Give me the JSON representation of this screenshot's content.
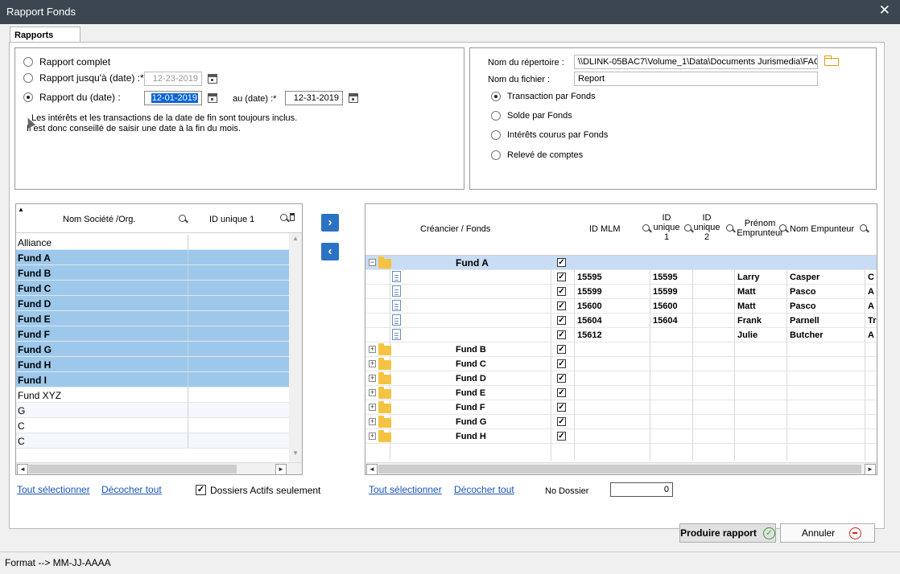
{
  "window": {
    "title": "Rapport Fonds",
    "close": "✕"
  },
  "tabs": {
    "active": "Rapports"
  },
  "report_options": {
    "full": "Rapport complet",
    "until": "Rapport jusqu'à (date) :*",
    "until_date": "12-23-2019",
    "from": "Rapport du (date) :",
    "from_date": "12-01-2019",
    "to_label": "au (date) :*",
    "to_date": "12-31-2019",
    "selected": "from",
    "note_line1": "Les intérêts et les transactions de la date de fin sont toujours inclus.",
    "note_line2": "Il est donc conseillé de saisir une date à la fin du mois."
  },
  "output": {
    "dir_label": "Nom du répertoire :",
    "dir_value": "\\\\DLINK-05BAC7\\Volume_1\\Data\\Documents Jurismedia\\FAC",
    "file_label": "Nom du fichier :",
    "file_value": "Report",
    "types": [
      "Transaction par Fonds",
      "Solde par Fonds",
      "Intérêts courus par Fonds",
      "Relevé de comptes"
    ],
    "selected_type": 0
  },
  "left_grid": {
    "sort_arrow": "▲",
    "col1": "Nom Société /Org.",
    "col2": "ID unique 1",
    "rows": [
      {
        "name": "Alliance",
        "selected": false
      },
      {
        "name": "Fund A",
        "selected": true
      },
      {
        "name": "Fund B",
        "selected": true
      },
      {
        "name": "Fund C",
        "selected": true
      },
      {
        "name": "Fund D",
        "selected": true
      },
      {
        "name": "Fund E",
        "selected": true
      },
      {
        "name": "Fund F",
        "selected": true
      },
      {
        "name": "Fund G",
        "selected": true
      },
      {
        "name": "Fund H",
        "selected": true
      },
      {
        "name": "Fund I",
        "selected": true
      },
      {
        "name": "Fund XYZ",
        "selected": false
      },
      {
        "name": "G",
        "selected": false
      },
      {
        "name": "C",
        "selected": false
      },
      {
        "name": "C",
        "selected": false
      }
    ]
  },
  "nav": {
    "add": "›",
    "remove": "‹"
  },
  "right_grid": {
    "h_creditor": "Créancier / Fonds",
    "h_mlm": "ID MLM",
    "h_uid1": "ID unique 1",
    "h_uid2": "ID unique 2",
    "h_firstname": "Prénom Emprunteur",
    "h_lastname": "Nom Empunteur",
    "rows": [
      {
        "type": "fund",
        "name": "Fund A",
        "expand": "−",
        "checked": true,
        "selected": true
      },
      {
        "type": "loan",
        "mlm": "15595",
        "uid1": "15595",
        "first": "Larry",
        "last": "Casper",
        "extra": "C",
        "checked": true
      },
      {
        "type": "loan",
        "mlm": "15599",
        "uid1": "15599",
        "first": "Matt",
        "last": "Pasco",
        "extra": "A",
        "checked": true
      },
      {
        "type": "loan",
        "mlm": "15600",
        "uid1": "15600",
        "first": "Matt",
        "last": "Pasco",
        "extra": "A",
        "checked": true
      },
      {
        "type": "loan",
        "mlm": "15604",
        "uid1": "15604",
        "first": "Frank",
        "last": "Parnell",
        "extra": "Tr",
        "checked": true
      },
      {
        "type": "loan",
        "mlm": "15612",
        "uid1": "",
        "first": "Julie",
        "last": "Butcher",
        "extra": "A",
        "checked": true
      },
      {
        "type": "fund",
        "name": "Fund B",
        "expand": "+",
        "checked": true
      },
      {
        "type": "fund",
        "name": "Fund C",
        "expand": "+",
        "checked": true
      },
      {
        "type": "fund",
        "name": "Fund D",
        "expand": "+",
        "checked": true
      },
      {
        "type": "fund",
        "name": "Fund E",
        "expand": "+",
        "checked": true
      },
      {
        "type": "fund",
        "name": "Fund F",
        "expand": "+",
        "checked": true
      },
      {
        "type": "fund",
        "name": "Fund G",
        "expand": "+",
        "checked": true
      },
      {
        "type": "fund",
        "name": "Fund H",
        "expand": "+",
        "checked": true
      }
    ]
  },
  "left_footer": {
    "select_all": "Tout sélectionner",
    "uncheck_all": "Décocher tout",
    "active_only": "Dossiers Actifs seulement",
    "active_only_checked": true
  },
  "right_footer": {
    "select_all": "Tout sélectionner",
    "uncheck_all": "Décocher tout",
    "dossier_label": "No Dossier",
    "dossier_value": "0"
  },
  "buttons": {
    "produce": "Produire rapport",
    "cancel": "Annuler",
    "ok_glyph": "✓"
  },
  "status": {
    "format": "Format --> MM-JJ-AAAA"
  },
  "glyphs": {
    "check": "✓",
    "left_arrow": "◄",
    "right_arrow": "►",
    "up_arrow": "▲",
    "down_arrow": "▼"
  }
}
